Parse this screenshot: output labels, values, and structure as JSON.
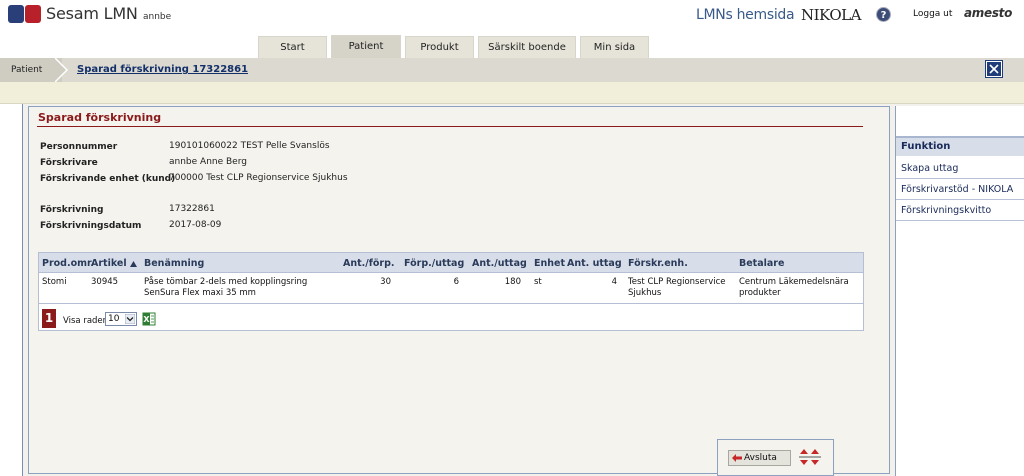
{
  "header": {
    "app_name": "Sesam LMN",
    "user": "annbe",
    "lmn_link": "LMNs hemsida",
    "nikola": "NIKOLA",
    "help": "?",
    "logout": "Logga ut",
    "vendor": "amesto"
  },
  "tabs": [
    {
      "label": "Start"
    },
    {
      "label": "Patient",
      "active": true
    },
    {
      "label": "Produkt"
    },
    {
      "label": "Särskilt boende"
    },
    {
      "label": "Min sida"
    }
  ],
  "breadcrumb": {
    "first": "Patient",
    "current": "Sparad förskrivning 17322861"
  },
  "section": {
    "title": "Sparad förskrivning"
  },
  "info": {
    "personnummer_label": "Personnummer",
    "personnummer_value": "190101060022 TEST Pelle Svanslös",
    "forskrivare_label": "Förskrivare",
    "forskrivare_value": "annbe Anne Berg",
    "enhet_label": "Förskrivande enhet (kund)",
    "enhet_value": "700000 Test CLP Regionservice Sjukhus",
    "forskrivning_label": "Förskrivning",
    "forskrivning_value": "17322861",
    "datum_label": "Förskrivningsdatum",
    "datum_value": "2017-08-09"
  },
  "table": {
    "headers": {
      "prod_omr": "Prod.omr.",
      "artikel": "Artikel",
      "benamning": "Benämning",
      "ant_forp": "Ant./förp.",
      "forp_uttag": "Förp./uttag",
      "ant_uttag": "Ant./uttag",
      "enhet": "Enhet",
      "ant_uttag2": "Ant. uttag",
      "forskr_enh": "Förskr.enh.",
      "betalare": "Betalare"
    },
    "row": {
      "prod_omr": "Stomi",
      "artikel": "30945",
      "benamning_1": "Påse tömbar 2-dels med kopplingsring",
      "benamning_2": "SenSura Flex maxi 35 mm",
      "ant_forp": "30",
      "forp_uttag": "6",
      "ant_uttag": "180",
      "enhet": "st",
      "ant_uttag2": "4",
      "forskr_enh_1": "Test CLP Regionservice",
      "forskr_enh_2": "Sjukhus",
      "betalare_1": "Centrum Läkemedelsnära",
      "betalare_2": "produkter"
    },
    "page_number": "1",
    "visa_rader_label": "Visa rader",
    "visa_rader_value": "10"
  },
  "buttons": {
    "avsluta": "Avsluta"
  },
  "right_panel": {
    "header": "Funktion",
    "items": [
      "Skapa uttag",
      "Förskrivarstöd - NIKOLA",
      "Förskrivningskvitto"
    ]
  },
  "colors": {
    "accent_red": "#8b1a1a",
    "nav_blue": "#1f3b7a",
    "table_header": "#d8dee9"
  }
}
